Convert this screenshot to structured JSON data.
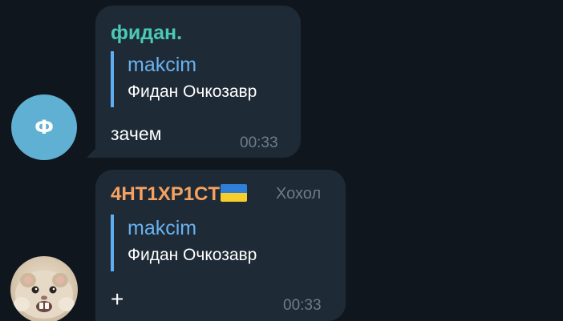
{
  "messages": [
    {
      "sender": "фидан.",
      "sender_color": "#4cc9b6",
      "avatar": {
        "type": "letter",
        "letter": "Ф",
        "color": "#5fb0d2"
      },
      "reply": {
        "name": "makcim",
        "text": "Фидан Очкозавр"
      },
      "text": "зачем",
      "time": "00:33"
    },
    {
      "sender": "4HT1XP1CT",
      "sender_color": "#f5a261",
      "sender_badge": "ukraine-flag-icon",
      "tag": "Хохол",
      "avatar": {
        "type": "photo",
        "subject": "hamster"
      },
      "reply": {
        "name": "makcim",
        "text": "Фидан Очкозавр"
      },
      "text": "+",
      "time": "00:33"
    }
  ],
  "colors": {
    "background": "#10161d",
    "bubble": "#1e2a36",
    "reply_accent": "#5eaef0",
    "muted": "#6f7d8a"
  }
}
